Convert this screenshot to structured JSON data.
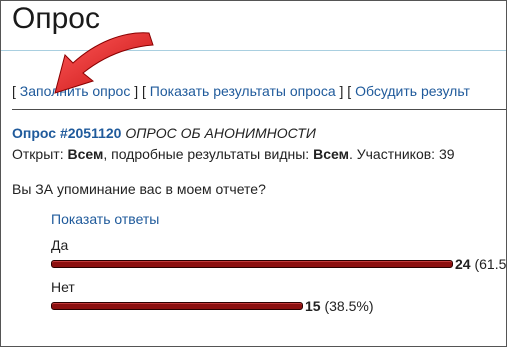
{
  "page": {
    "title": "Опрос"
  },
  "nav": {
    "open": "[",
    "fill_label": "Заполнить опрос",
    "sep1": " ] [ ",
    "results_label": "Показать результаты опроса",
    "sep2": " ] [ ",
    "discuss_label": "Обсудить результ"
  },
  "poll": {
    "prefix": "Опрос",
    "number": "#2051120",
    "name": "ОПРОС ОБ АНОНИМНОСТИ",
    "info": {
      "open_label": "Открыт:",
      "open_value": "Всем",
      "details_label": ", подробные результаты видны:",
      "details_value": "Всем",
      "participants_label": ". Участников: 39"
    },
    "question": "Вы ЗА упоминание вас в моем отчете?",
    "show_answers": "Показать ответы",
    "options": [
      {
        "label": "Да",
        "count": "24",
        "percent": "(61.5",
        "fraction": 0.615
      },
      {
        "label": "Нет",
        "count": "15",
        "percent": "(38.5%)",
        "fraction": 0.385
      }
    ]
  },
  "colors": {
    "bar": "#8c1010",
    "arrow": "#e02020",
    "link": "#1f5a9b"
  },
  "icons": {
    "arrow": "red-arrow-icon"
  }
}
